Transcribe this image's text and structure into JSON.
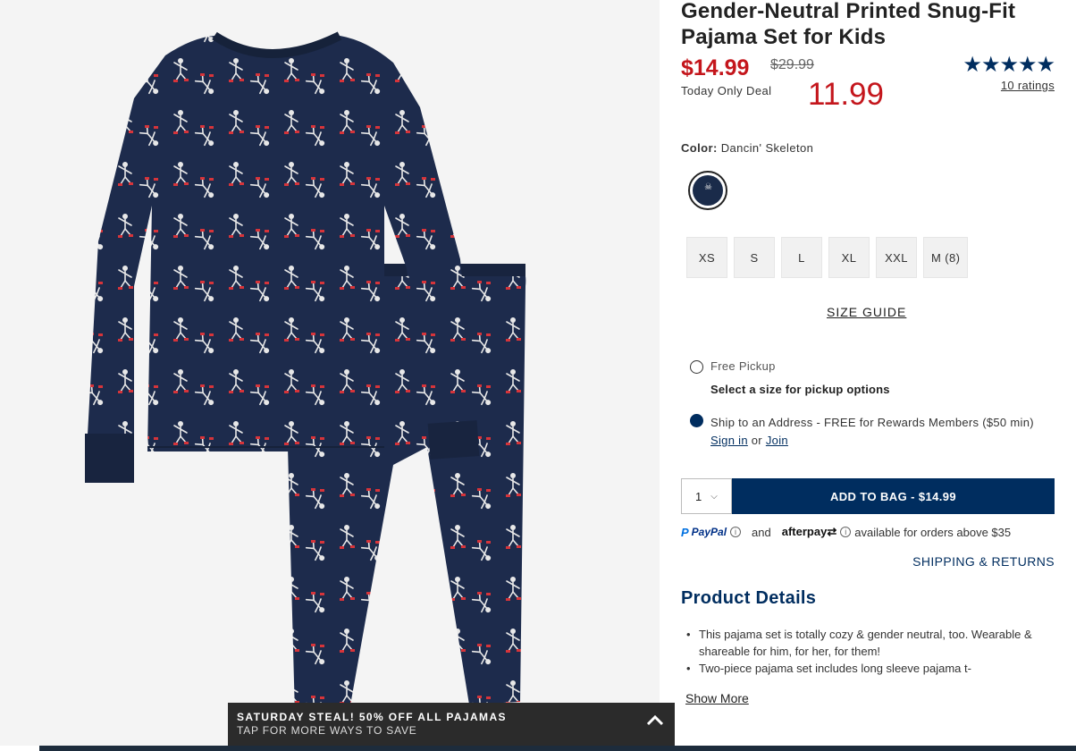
{
  "product": {
    "title": "Gender-Neutral Printed Snug-Fit Pajama Set for Kids",
    "price_now": "$14.99",
    "price_was": "$29.99",
    "deal_label": "Today Only Deal",
    "deal_price": "11.99",
    "stars": "★★★★★",
    "ratings_label": "10 ratings",
    "rating_value": 5
  },
  "color": {
    "label": "Color:",
    "value": "Dancin' Skeleton"
  },
  "sizes": [
    "XS",
    "S",
    "L",
    "XL",
    "XXL",
    "M (8)"
  ],
  "size_guide": "SIZE GUIDE",
  "fulfillment": {
    "pickup_label": "Free Pickup",
    "pickup_sub": "Select a size for pickup options",
    "ship_text": "Ship to an Address - FREE for Rewards Members ($50 min)",
    "sign_in": "Sign in",
    "or": "or",
    "join": "Join",
    "selected": "ship"
  },
  "bag": {
    "quantity": "1",
    "add_label": "ADD TO BAG  -  $14.99"
  },
  "payment": {
    "paypal": "PayPal",
    "and": "and",
    "afterpay": "afterpay",
    "afterpay_note": "available for orders above $35"
  },
  "shipping_returns": "SHIPPING & RETURNS",
  "details": {
    "title": "Product Details",
    "bullets": [
      "This pajama set is totally cozy & gender neutral, too. Wearable & shareable for him, for her, for them!",
      "Two-piece pajama set includes long sleeve pajama t-"
    ],
    "show_more": "Show More"
  },
  "promo": {
    "headline": "SATURDAY STEAL! 50% OFF ALL PAJAMAS",
    "subline": "TAP FOR MORE WAYS TO SAVE"
  },
  "colors": {
    "navy": "#002d5f",
    "sale_red": "#c4161c",
    "fabric": "#1d2b4c",
    "banner": "#2b2b2b"
  }
}
